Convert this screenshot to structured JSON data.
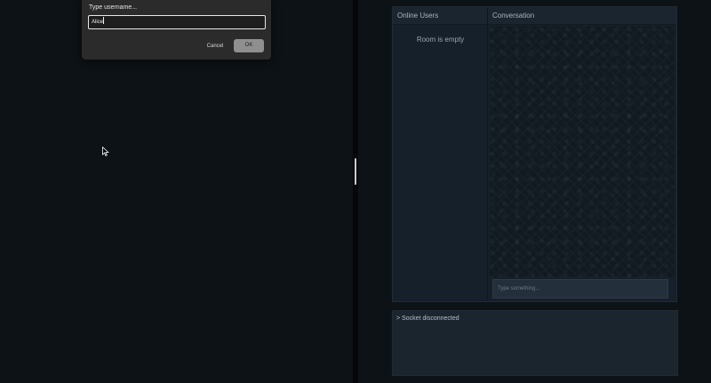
{
  "dialog": {
    "title": "Type username...",
    "input_value": "Alice",
    "cancel_label": "Cancel",
    "ok_label": "OK"
  },
  "chat": {
    "users_header": "Online Users",
    "room_empty": "Room is empty",
    "conversation_header": "Conversation",
    "message_placeholder": "Type something..."
  },
  "console": {
    "line": "> Socket disconnected"
  },
  "icons": {
    "cursor": "mouse-pointer-icon"
  },
  "colors": {
    "background": "#0c1115",
    "panel": "#16202a",
    "ok_button": "#8f8f8f"
  }
}
